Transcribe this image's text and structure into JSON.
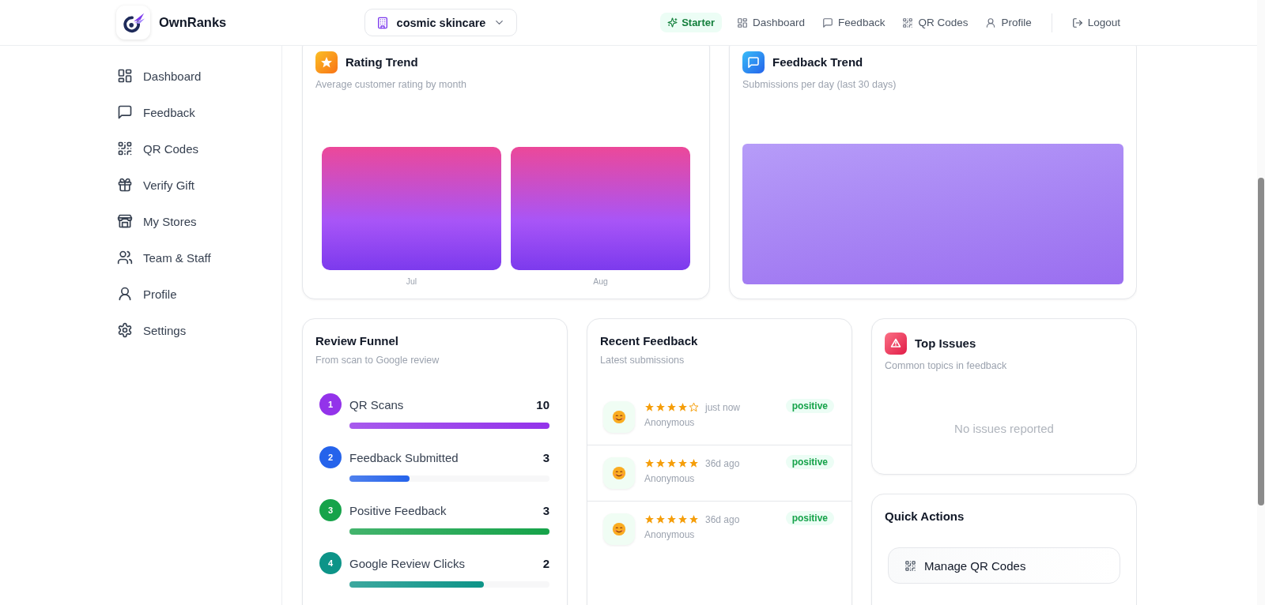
{
  "header": {
    "brand": "OwnRanks",
    "store": "cosmic skincare",
    "plan": "Starter",
    "nav": [
      "Dashboard",
      "Feedback",
      "QR Codes",
      "Profile"
    ],
    "logout": "Logout"
  },
  "sidebar": {
    "items": [
      {
        "label": "Dashboard"
      },
      {
        "label": "Feedback"
      },
      {
        "label": "QR Codes"
      },
      {
        "label": "Verify Gift"
      },
      {
        "label": "My Stores"
      },
      {
        "label": "Team & Staff"
      },
      {
        "label": "Profile"
      },
      {
        "label": "Settings"
      }
    ]
  },
  "rating_trend": {
    "title": "Rating Trend",
    "subtitle": "Average customer rating by month",
    "months": [
      "Jul",
      "Aug"
    ]
  },
  "feedback_trend": {
    "title": "Feedback Trend",
    "subtitle": "Submissions per day (last 30 days)"
  },
  "review_funnel": {
    "title": "Review Funnel",
    "subtitle": "From scan to Google review",
    "steps": [
      {
        "number": "1",
        "label": "QR Scans",
        "count": "10",
        "level": 1,
        "color": "#9333ea"
      },
      {
        "number": "2",
        "label": "Feedback Submitted",
        "count": "3",
        "level": 0.3,
        "color": "#2563eb"
      },
      {
        "number": "3",
        "label": "Positive Feedback",
        "count": "3",
        "level": 1,
        "color": "#16a34a"
      },
      {
        "number": "4",
        "label": "Google Review Clicks",
        "count": "2",
        "level": 0.67,
        "color": "#0d9488"
      }
    ]
  },
  "recent_feedback": {
    "title": "Recent Feedback",
    "subtitle": "Latest submissions",
    "items": [
      {
        "stars": 4,
        "time": "just now",
        "author": "Anonymous",
        "sentiment": "positive"
      },
      {
        "stars": 5,
        "time": "36d ago",
        "author": "Anonymous",
        "sentiment": "positive"
      },
      {
        "stars": 5,
        "time": "36d ago",
        "author": "Anonymous",
        "sentiment": "positive"
      }
    ]
  },
  "top_issues": {
    "title": "Top Issues",
    "subtitle": "Common topics in feedback",
    "empty": "No issues reported"
  },
  "quick_actions": {
    "title": "Quick Actions",
    "actions": [
      {
        "label": "Manage QR Codes"
      }
    ]
  }
}
